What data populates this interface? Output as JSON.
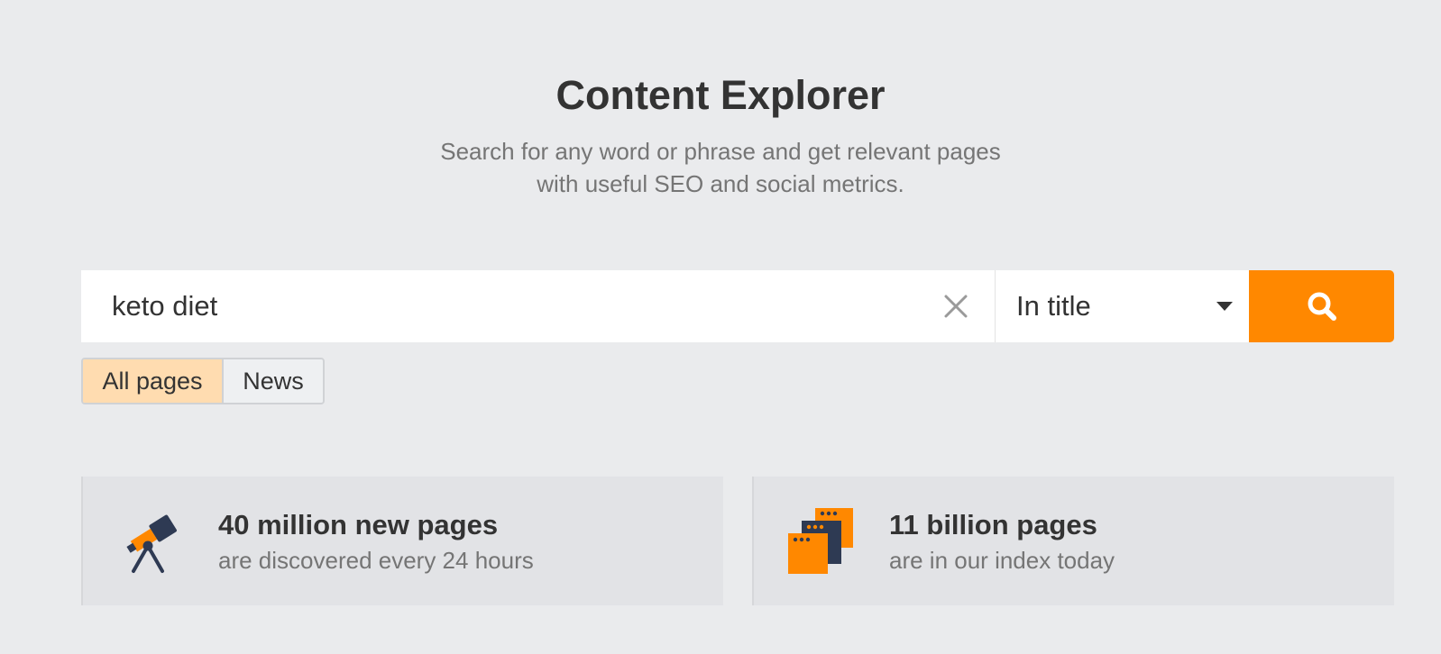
{
  "header": {
    "title": "Content Explorer",
    "subtitle_line1": "Search for any word or phrase and get relevant pages",
    "subtitle_line2": "with useful SEO and social metrics."
  },
  "search": {
    "value": "keto diet",
    "clear_icon": "close-icon",
    "mode": {
      "selected": "In title",
      "icon": "caret-down-icon"
    },
    "submit_icon": "search-icon"
  },
  "filters": {
    "options": [
      "All pages",
      "News"
    ],
    "selected": "All pages"
  },
  "stats": [
    {
      "icon": "telescope-icon",
      "headline": "40 million new pages",
      "caption": "are discovered every 24 hours"
    },
    {
      "icon": "stacked-pages-icon",
      "headline": "11 billion pages",
      "caption": "are in our index today"
    }
  ],
  "colors": {
    "accent": "#ff8800",
    "background": "#eaebed",
    "card": "#e2e3e6",
    "selected_filter": "#ffdcb0",
    "dark_icon": "#2e3a53",
    "text": "#333333",
    "muted_text": "#757575"
  }
}
